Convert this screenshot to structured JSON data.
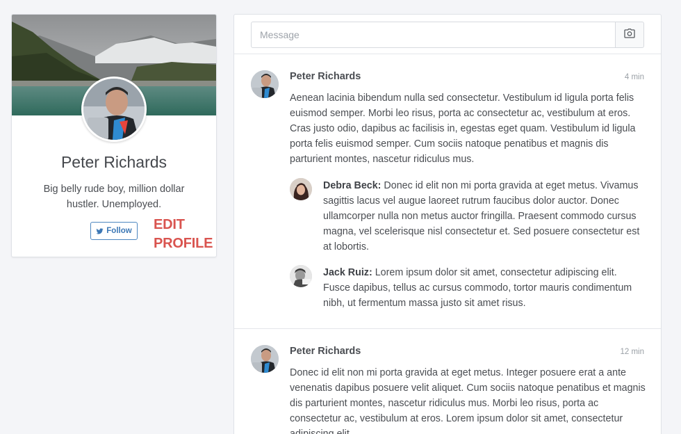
{
  "profile": {
    "name": "Peter Richards",
    "bio": "Big belly rude boy, million dollar hustler. Unemployed.",
    "follow_label": "Follow",
    "edit_line1": "EDIT",
    "edit_line2": "PROFILE"
  },
  "composer": {
    "placeholder": "Message",
    "camera_icon": "camera-icon"
  },
  "posts": [
    {
      "author": "Peter Richards",
      "time": "4 min",
      "text": "Aenean lacinia bibendum nulla sed consectetur. Vestibulum id ligula porta felis euismod semper. Morbi leo risus, porta ac consectetur ac, vestibulum at eros. Cras justo odio, dapibus ac facilisis in, egestas eget quam. Vestibulum id ligula porta felis euismod semper. Cum sociis natoque penatibus et magnis dis parturient montes, nascetur ridiculus mus.",
      "replies": [
        {
          "author": "Debra Beck:",
          "text": "Donec id elit non mi porta gravida at eget metus. Vivamus sagittis lacus vel augue laoreet rutrum faucibus dolor auctor. Donec ullamcorper nulla non metus auctor fringilla. Praesent commodo cursus magna, vel scelerisque nisl consectetur et. Sed posuere consectetur est at lobortis."
        },
        {
          "author": "Jack Ruiz:",
          "text": "Lorem ipsum dolor sit amet, consectetur adipiscing elit. Fusce dapibus, tellus ac cursus commodo, tortor mauris condimentum nibh, ut fermentum massa justo sit amet risus."
        }
      ]
    },
    {
      "author": "Peter Richards",
      "time": "12 min",
      "text": "Donec id elit non mi porta gravida at eget metus. Integer posuere erat a ante venenatis dapibus posuere velit aliquet. Cum sociis natoque penatibus et magnis dis parturient montes, nascetur ridiculus mus. Morbi leo risus, porta ac consectetur ac, vestibulum at eros. Lorem ipsum dolor sit amet, consectetur adipiscing elit."
    }
  ],
  "colors": {
    "accent_blue": "#3d78b5",
    "edit_red": "#d9544f",
    "background": "#f4f5f8"
  }
}
